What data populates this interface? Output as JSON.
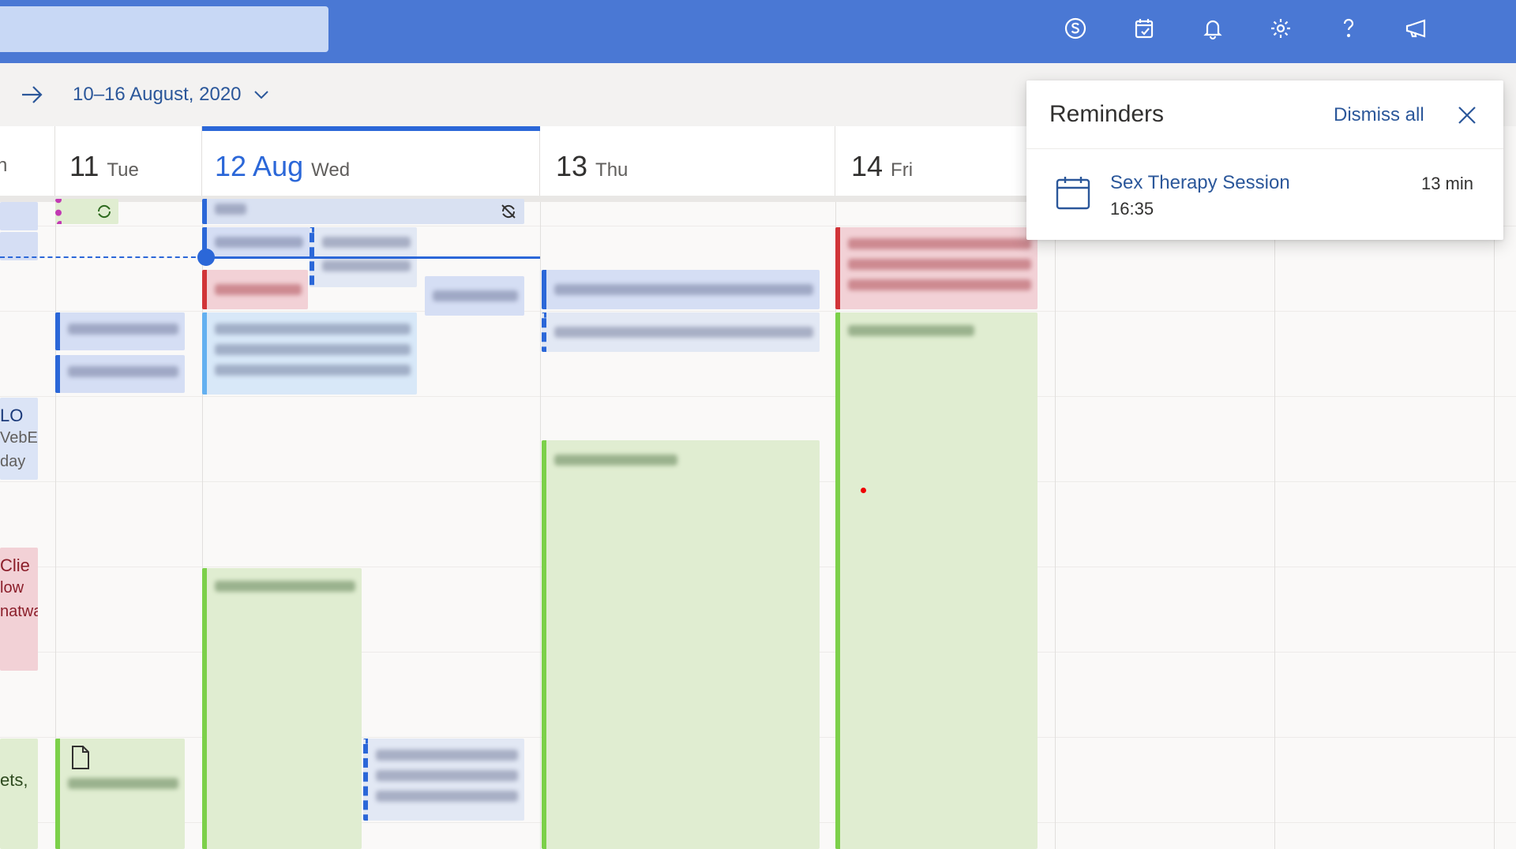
{
  "header": {
    "search_placeholder": "",
    "icons": [
      "skype-icon",
      "todo-icon",
      "bell-icon",
      "gear-icon",
      "help-icon",
      "megaphone-icon"
    ]
  },
  "toolbar": {
    "date_range": "10–16 August, 2020"
  },
  "days": [
    {
      "num": "11",
      "weekday": "Tue",
      "today": false
    },
    {
      "num": "12 Aug",
      "weekday": "Wed",
      "today": true
    },
    {
      "num": "13",
      "weekday": "Thu",
      "today": false
    },
    {
      "num": "14",
      "weekday": "Fri",
      "today": false
    }
  ],
  "left_column_fragments": {
    "a1": "LO",
    "a2": "VebE",
    "a3": "day",
    "b1": "Clie",
    "b2": "low",
    "b3": "natwa",
    "c1": "ets,"
  },
  "reminders": {
    "title": "Reminders",
    "dismiss_all": "Dismiss all",
    "item": {
      "title": "Sex Therapy Session",
      "time": "16:35",
      "due": "13 min"
    }
  },
  "colors": {
    "header_bg": "#4a78d4",
    "accent": "#2b67d8",
    "event_green": "#e0edd1",
    "event_red": "#f2d1d6",
    "event_blue": "#d5def4"
  }
}
